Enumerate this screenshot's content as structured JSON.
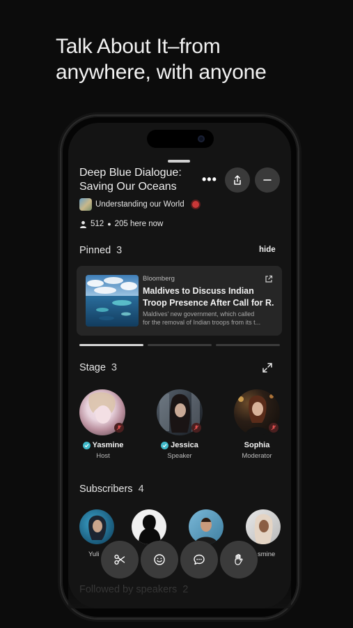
{
  "headline": {
    "line1": "Talk About It–from",
    "line2": "anywhere, with anyone"
  },
  "room": {
    "title_line1": "Deep Blue Dialogue:",
    "title_line2": "Saving Our Oceans",
    "more_icon": "more-dots-icon",
    "share_icon": "share-icon",
    "minimize_icon": "minus-icon",
    "community": "Understanding our World",
    "subscribers_count": "512",
    "here_now": "205 here now"
  },
  "pinned": {
    "label": "Pinned",
    "count": "3",
    "hide_label": "hide",
    "card": {
      "source": "Bloomberg",
      "title_line1": "Maldives to Discuss Indian",
      "title_line2": "Troop Presence After Call for R...",
      "desc_line1": "Maldives' new government, which called",
      "desc_line2": "for the removal of Indian troops from its t..."
    }
  },
  "stage": {
    "label": "Stage",
    "count": "3",
    "speakers": [
      {
        "name": "Yasmine",
        "role": "Host",
        "verified": true
      },
      {
        "name": "Jessica",
        "role": "Speaker",
        "verified": true
      },
      {
        "name": "Sophia",
        "role": "Moderator",
        "verified": false
      }
    ]
  },
  "subscribers": {
    "label": "Subscribers",
    "count": "4",
    "members": [
      {
        "name": "Yuli"
      },
      {
        "name": ""
      },
      {
        "name": ""
      },
      {
        "name": "smine"
      }
    ]
  },
  "followed": {
    "label": "Followed by speakers",
    "count": "2"
  },
  "actions": [
    {
      "icon": "scissors-icon"
    },
    {
      "icon": "smiley-icon"
    },
    {
      "icon": "chat-bubble-icon"
    },
    {
      "icon": "raise-hand-icon"
    }
  ],
  "colors": {
    "accent": "#3fb9c9",
    "live": "#c93838",
    "card": "#262626",
    "button": "#3b3b3b"
  }
}
